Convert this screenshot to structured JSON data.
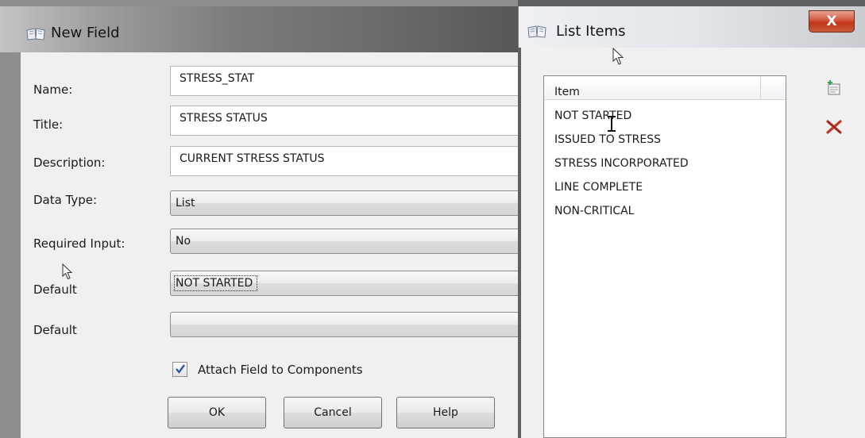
{
  "new_field_dialog": {
    "title": "New Field",
    "labels": {
      "name": "Name:",
      "title": "Title:",
      "description": "Description:",
      "data_type": "Data Type:",
      "required_input": "Required Input:",
      "default_1": "Default",
      "default_2": "Default"
    },
    "fields": {
      "name": "STRESS_STAT",
      "title": "STRESS STATUS",
      "description": "CURRENT STRESS STATUS"
    },
    "combos": {
      "data_type": "List",
      "required_input": "No",
      "default_1": "NOT STARTED",
      "default_2": ""
    },
    "attach_checkbox": {
      "label": "Attach Field to Components",
      "checked": true
    },
    "buttons": {
      "ok": "OK",
      "cancel": "Cancel",
      "help": "Help"
    }
  },
  "list_items_dialog": {
    "title": "List Items",
    "close_label": "X",
    "column_header": "Item",
    "items": [
      "NOT STARTED",
      "ISSUED TO STRESS",
      "STRESS INCORPORATED",
      "LINE COMPLETE",
      "NON-CRITICAL"
    ],
    "tool_icons": [
      "add-item-icon",
      "delete-item-icon"
    ]
  },
  "colors": {
    "close_button": "#c43519",
    "delete_icon": "#c0392b",
    "checkbox_check": "#2a5aa7"
  }
}
